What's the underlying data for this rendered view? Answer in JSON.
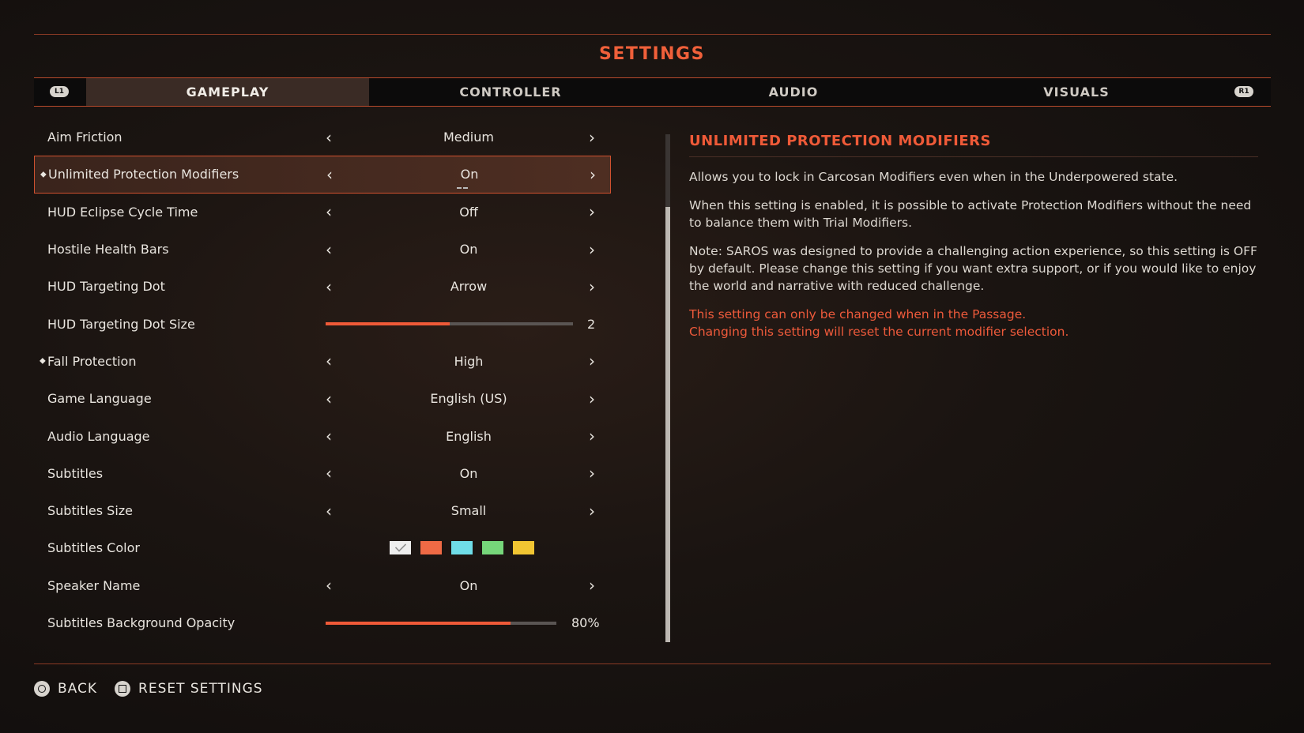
{
  "header": {
    "title": "SETTINGS"
  },
  "tabs": [
    {
      "label": "GAMEPLAY",
      "active": true
    },
    {
      "label": "CONTROLLER",
      "active": false
    },
    {
      "label": "AUDIO",
      "active": false
    },
    {
      "label": "VISUALS",
      "active": false
    }
  ],
  "bumpers": {
    "left": "L1",
    "right": "R1"
  },
  "settings": [
    {
      "label": "Aim Friction",
      "type": "option",
      "value": "Medium"
    },
    {
      "label": "Unlimited Protection Modifiers",
      "type": "option",
      "value": "On",
      "selected": true,
      "dot": true
    },
    {
      "label": "HUD Eclipse Cycle Time",
      "type": "option",
      "value": "Off"
    },
    {
      "label": "Hostile Health Bars",
      "type": "option",
      "value": "On"
    },
    {
      "label": "HUD Targeting Dot",
      "type": "option",
      "value": "Arrow"
    },
    {
      "label": "HUD Targeting Dot Size",
      "type": "slider",
      "value": "2",
      "fraction": 0.5
    },
    {
      "label": "Fall Protection",
      "type": "option",
      "value": "High",
      "dot": true
    },
    {
      "label": "Game Language",
      "type": "option",
      "value": "English (US)"
    },
    {
      "label": "Audio Language",
      "type": "option",
      "value": "English"
    },
    {
      "label": "Subtitles",
      "type": "option",
      "value": "On"
    },
    {
      "label": "Subtitles Size",
      "type": "option",
      "value": "Small"
    },
    {
      "label": "Subtitles Color",
      "type": "colors",
      "colors": [
        "#eeeeee",
        "#ef6a45",
        "#6fdde8",
        "#76d67a",
        "#f1c532"
      ],
      "selected_color": 0
    },
    {
      "label": "Speaker Name",
      "type": "option",
      "value": "On"
    },
    {
      "label": "Subtitles Background Opacity",
      "type": "slider",
      "value": "80%",
      "fraction": 0.8
    }
  ],
  "info": {
    "title": "UNLIMITED PROTECTION MODIFIERS",
    "paragraphs": [
      "Allows you to lock in Carcosan Modifiers even when in the Underpowered state.",
      "When this setting is enabled, it is possible to activate Protection Modifiers without the need to balance them with Trial Modifiers.",
      "Note: SAROS was designed to provide a challenging action experience, so this setting is OFF by default. Please change this setting if you want extra support, or if you would like to enjoy the world and narrative with reduced challenge."
    ],
    "warnings": [
      "This setting can only be changed when in the Passage.",
      "Changing this setting will reset the current modifier selection."
    ]
  },
  "footer": {
    "back": "BACK",
    "reset": "RESET SETTINGS"
  },
  "colors": {
    "accent": "#ef5a38",
    "border": "#b84a2c"
  }
}
